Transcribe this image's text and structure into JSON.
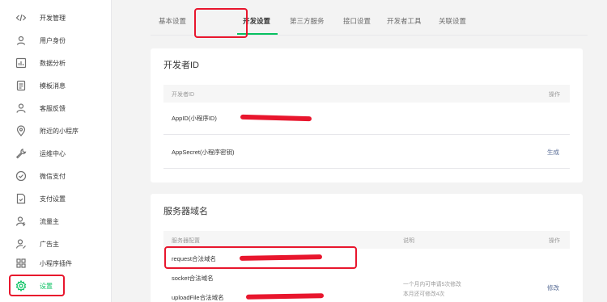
{
  "sidebar": {
    "items": [
      {
        "label": "开发管理",
        "icon": "code-icon"
      },
      {
        "label": "用户身份",
        "icon": "user-id-icon"
      },
      {
        "label": "数据分析",
        "icon": "chart-icon"
      },
      {
        "label": "模板消息",
        "icon": "document-icon"
      },
      {
        "label": "客服反馈",
        "icon": "person-icon"
      },
      {
        "label": "附近的小程序",
        "icon": "location-icon"
      },
      {
        "label": "运维中心",
        "icon": "wrench-icon"
      },
      {
        "label": "微信支付",
        "icon": "check-circle-icon"
      },
      {
        "label": "支付设置",
        "icon": "file-check-icon"
      },
      {
        "label": "流量主",
        "icon": "user-bolt-icon"
      },
      {
        "label": "广告主",
        "icon": "user-edit-icon"
      },
      {
        "label": "小程序插件",
        "icon": "grid-icon"
      },
      {
        "label": "设置",
        "icon": "gear-icon"
      }
    ],
    "active_index": 12
  },
  "tabs": [
    {
      "label": "基本设置"
    },
    {
      "label": "开发设置"
    },
    {
      "label": "第三方服务"
    },
    {
      "label": "接口设置"
    },
    {
      "label": "开发者工具"
    },
    {
      "label": "关联设置"
    }
  ],
  "active_tab": 1,
  "developer_id": {
    "title": "开发者ID",
    "col_id": "开发者ID",
    "col_action": "操作",
    "rows": [
      {
        "label": "AppID(小程序ID)",
        "action": ""
      },
      {
        "label": "AppSecret(小程序密钥)",
        "action": "生成"
      }
    ]
  },
  "server_domain": {
    "title": "服务器域名",
    "col_config": "服务器配置",
    "col_desc": "说明",
    "col_action": "操作",
    "rows": [
      {
        "label": "request合法域名"
      },
      {
        "label": "socket合法域名"
      },
      {
        "label": "uploadFile合法域名"
      }
    ],
    "desc_line1": "一个月内可申请5次修改",
    "desc_line2": "本月还可修改4次",
    "action": "修改"
  },
  "colors": {
    "accent": "#07c160",
    "highlight": "#e8162d",
    "link": "#576b95"
  }
}
